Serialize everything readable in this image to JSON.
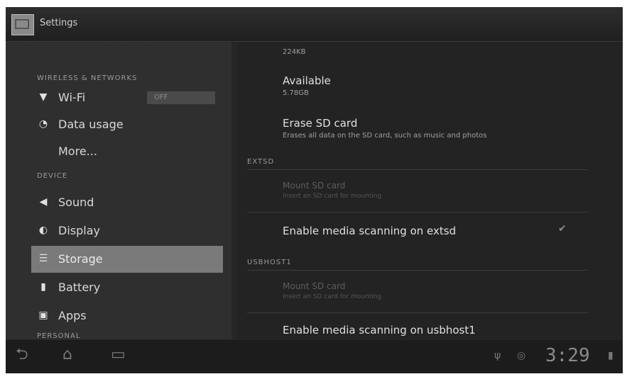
{
  "header": {
    "title": "Settings"
  },
  "sidebar": {
    "sections": {
      "wireless": "WIRELESS & NETWORKS",
      "device": "DEVICE",
      "personal": "PERSONAL"
    },
    "items": [
      {
        "label": "Wi-Fi",
        "icon": "wifi-icon"
      },
      {
        "label": "Data usage",
        "icon": "data-usage-icon"
      },
      {
        "label": "More...",
        "icon": ""
      },
      {
        "label": "Sound",
        "icon": "speaker-icon"
      },
      {
        "label": "Display",
        "icon": "display-icon"
      },
      {
        "label": "Storage",
        "icon": "storage-icon",
        "selected": true
      },
      {
        "label": "Battery",
        "icon": "battery-icon"
      },
      {
        "label": "Apps",
        "icon": "apps-icon"
      }
    ],
    "wifi_toggle": "OFF"
  },
  "main": {
    "partial": "224KB",
    "available": {
      "title": "Available",
      "value": "5.78GB"
    },
    "erase": {
      "title": "Erase SD card",
      "subtitle": "Erases all data on the SD card, such as music and photos"
    },
    "sections": {
      "extsd": "EXTSD",
      "usbhost": "USBHOST1"
    },
    "mount_extsd": {
      "title": "Mount SD card",
      "subtitle": "Insert an SD card for mounting"
    },
    "scan_extsd": "Enable media scanning on extsd",
    "mount_usb": {
      "title": "Mount SD card",
      "subtitle": "Insert an SD card for mounting"
    },
    "scan_usb": "Enable media scanning on usbhost1"
  },
  "status": {
    "time": "3:29"
  },
  "colors": {
    "selected": "#7a7a7a",
    "background": "#262626"
  }
}
